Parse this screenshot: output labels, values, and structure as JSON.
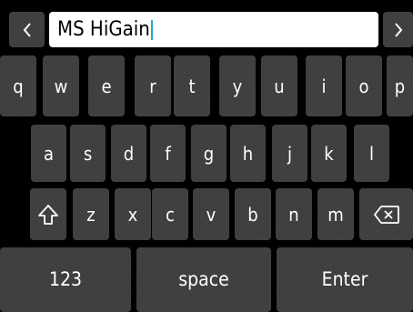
{
  "input": {
    "value": "MS HiGain"
  },
  "nav": {
    "prev_icon": "chevron-left-icon",
    "next_icon": "chevron-right-icon"
  },
  "rows": {
    "row1": [
      "q",
      "w",
      "e",
      "r",
      "t",
      "y",
      "u",
      "i",
      "o",
      "p"
    ],
    "row2": [
      "a",
      "s",
      "d",
      "f",
      "g",
      "h",
      "j",
      "k",
      "l"
    ],
    "row3": [
      "z",
      "x",
      "c",
      "v",
      "b",
      "n",
      "m"
    ]
  },
  "special": {
    "shift_icon": "shift-arrow-icon",
    "backspace_icon": "backspace-icon",
    "numbers": "123",
    "space": "space",
    "enter": "Enter"
  },
  "colors": {
    "key": "#3d3d3d",
    "background": "#000000",
    "caret": "#22a6d6",
    "text": "#ffffff"
  }
}
